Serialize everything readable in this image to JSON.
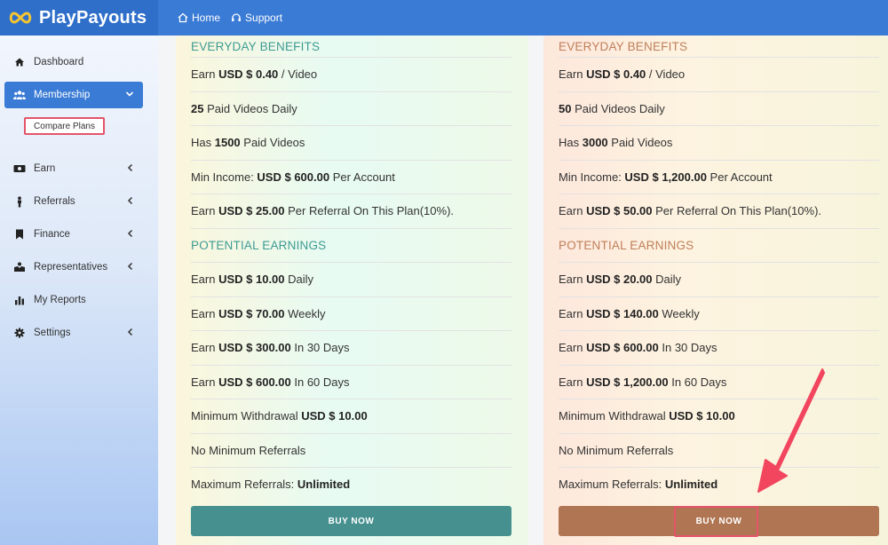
{
  "brand": {
    "name": "PlayPayouts"
  },
  "topnav": [
    {
      "label": "Home",
      "icon": "home-icon"
    },
    {
      "label": "Support",
      "icon": "headset-icon"
    }
  ],
  "sidebar": {
    "items": [
      {
        "label": "Dashboard",
        "icon": "home-icon"
      },
      {
        "label": "Membership",
        "icon": "users-icon"
      },
      {
        "label": "Earn",
        "icon": "money-icon"
      },
      {
        "label": "Referrals",
        "icon": "person-icon"
      },
      {
        "label": "Finance",
        "icon": "bookmark-icon"
      },
      {
        "label": "Representatives",
        "icon": "handshake-icon"
      },
      {
        "label": "My Reports",
        "icon": "chart-icon"
      },
      {
        "label": "Settings",
        "icon": "gear-icon"
      }
    ],
    "sub_item": "Compare Plans"
  },
  "plans": [
    {
      "everyday_title": "EVERYDAY BENEFITS",
      "rows": [
        {
          "pre": "Earn ",
          "bold": "USD $ 0.40",
          "post": " / Video"
        },
        {
          "pre": "",
          "bold": "25",
          "post": " Paid Videos Daily"
        },
        {
          "pre": "Has ",
          "bold": "1500",
          "post": " Paid Videos"
        },
        {
          "pre": "Min Income: ",
          "bold": "USD $ 600.00",
          "post": " Per Account"
        },
        {
          "pre": "Earn ",
          "bold": "USD $ 25.00",
          "post": " Per Referral On This Plan(10%)."
        }
      ],
      "potential_title": "POTENTIAL EARNINGS",
      "potential_rows": [
        {
          "pre": "Earn ",
          "bold": "USD $ 10.00",
          "post": " Daily"
        },
        {
          "pre": "Earn ",
          "bold": "USD $ 70.00",
          "post": " Weekly"
        },
        {
          "pre": "Earn ",
          "bold": "USD $ 300.00",
          "post": " In 30 Days"
        },
        {
          "pre": "Earn ",
          "bold": "USD $ 600.00",
          "post": " In 60 Days"
        },
        {
          "pre": "Minimum Withdrawal ",
          "bold": "USD $ 10.00",
          "post": ""
        },
        {
          "pre": "No Minimum Referrals",
          "bold": "",
          "post": ""
        },
        {
          "pre": "Maximum Referrals: ",
          "bold": "Unlimited",
          "post": ""
        }
      ],
      "buy_label": "BUY NOW"
    },
    {
      "everyday_title": "EVERYDAY BENEFITS",
      "rows": [
        {
          "pre": "Earn ",
          "bold": "USD $ 0.40",
          "post": " / Video"
        },
        {
          "pre": "",
          "bold": "50",
          "post": " Paid Videos Daily"
        },
        {
          "pre": "Has ",
          "bold": "3000",
          "post": " Paid Videos"
        },
        {
          "pre": "Min Income: ",
          "bold": "USD $ 1,200.00",
          "post": " Per Account"
        },
        {
          "pre": "Earn ",
          "bold": "USD $ 50.00",
          "post": " Per Referral On This Plan(10%)."
        }
      ],
      "potential_title": "POTENTIAL EARNINGS",
      "potential_rows": [
        {
          "pre": "Earn ",
          "bold": "USD $ 20.00",
          "post": " Daily"
        },
        {
          "pre": "Earn ",
          "bold": "USD $ 140.00",
          "post": " Weekly"
        },
        {
          "pre": "Earn ",
          "bold": "USD $ 600.00",
          "post": " In 30 Days"
        },
        {
          "pre": "Earn ",
          "bold": "USD $ 1,200.00",
          "post": " In 60 Days"
        },
        {
          "pre": "Minimum Withdrawal ",
          "bold": "USD $ 10.00",
          "post": ""
        },
        {
          "pre": "No Minimum Referrals",
          "bold": "",
          "post": ""
        },
        {
          "pre": "Maximum Referrals: ",
          "bold": "Unlimited",
          "post": ""
        }
      ],
      "buy_label": "BUY NOW"
    }
  ],
  "colors": {
    "topbar": "#3a7bd5",
    "highlight": "#e4546a",
    "left_accent": "#3e9b93",
    "right_accent": "#c07f5a",
    "left_button": "#46908f",
    "right_button": "#b07553"
  }
}
